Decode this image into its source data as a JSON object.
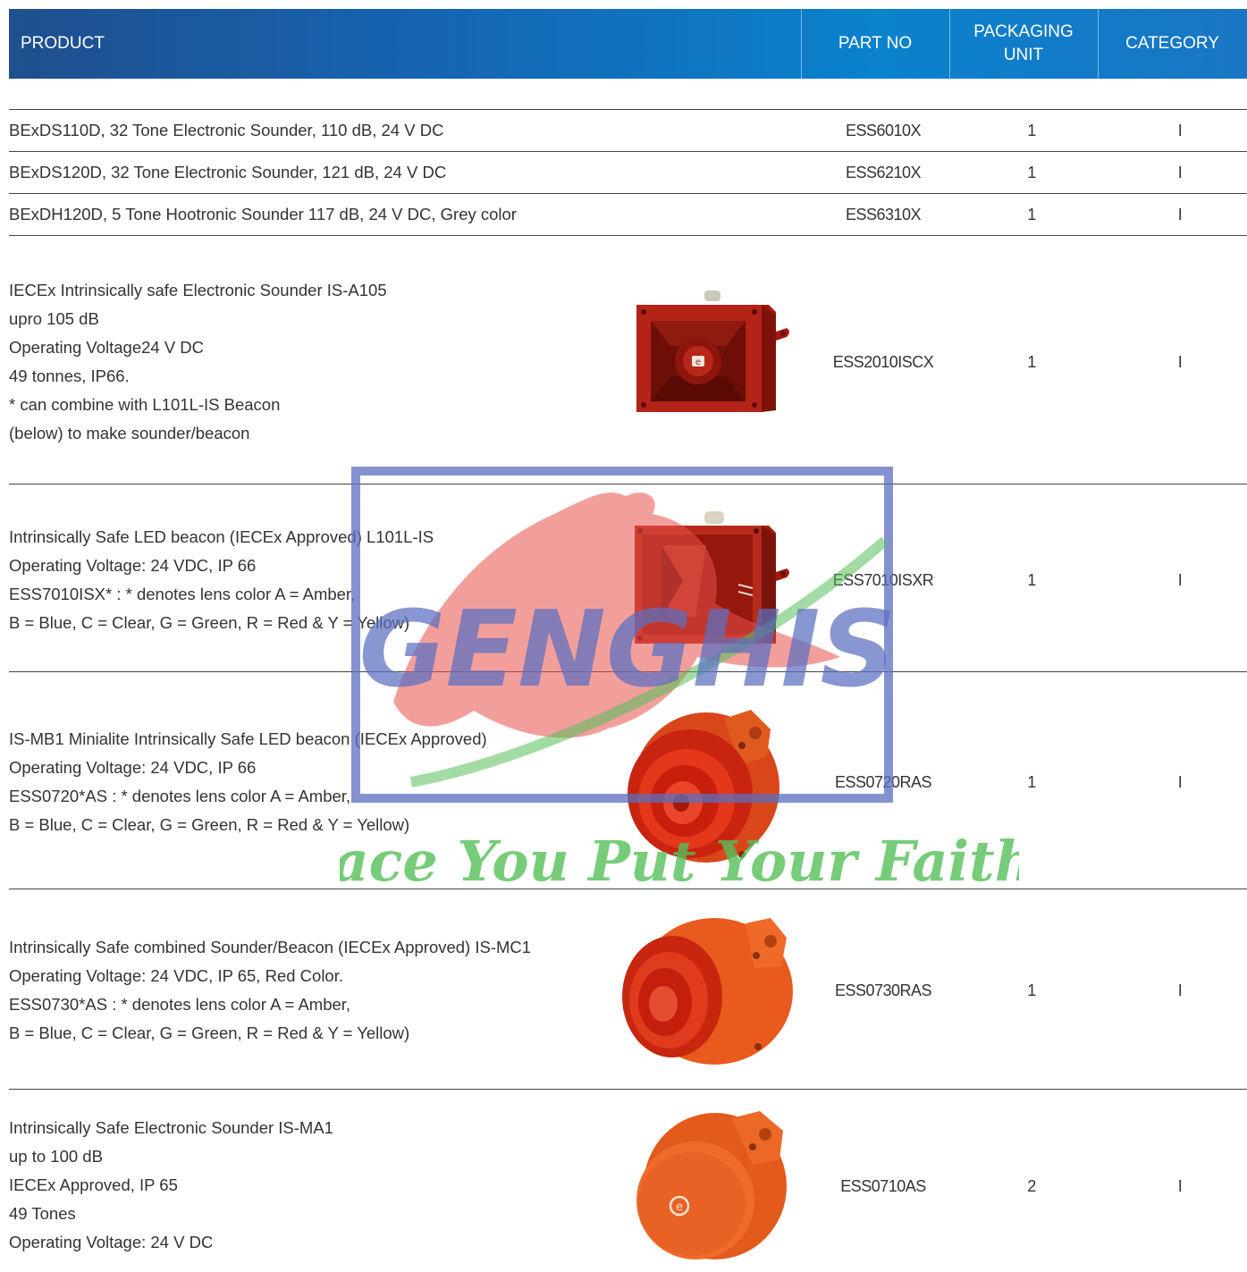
{
  "header": {
    "product": "PRODUCT",
    "part_no": "PART NO",
    "packaging_unit_line1": "PACKAGING",
    "packaging_unit_line2": "UNIT",
    "category": "CATEGORY",
    "gradient_colors": [
      "#1f4f8e",
      "#0a82cc"
    ]
  },
  "rows": [
    {
      "lines": [
        "BExDS110D, 32 Tone Electronic Sounder, 110 dB, 24 V DC"
      ],
      "part_no": "ESS6010X",
      "unit": "1",
      "category": "I"
    },
    {
      "lines": [
        "BExDS120D, 32 Tone Electronic Sounder, 121 dB, 24 V DC"
      ],
      "part_no": "ESS6210X",
      "unit": "1",
      "category": "I"
    },
    {
      "lines": [
        "BExDH120D, 5 Tone Hootronic Sounder 117 dB, 24 V DC, Grey color"
      ],
      "part_no": "ESS6310X",
      "unit": "1",
      "category": "I"
    },
    {
      "lines": [
        "IECEx Intrinsically safe Electronic Sounder IS-A105",
        "upro 105 dB",
        "Operating Voltage24 V DC",
        "49 tonnes, IP66.",
        "* can combine with L101L-IS Beacon",
        "(below) to make sounder/beacon"
      ],
      "part_no": "ESS2010ISCX",
      "unit": "1",
      "category": "I",
      "image": "sounder-box"
    },
    {
      "lines": [
        "Intrinsically Safe LED beacon (IECEx Approved) L101L-IS",
        "Operating Voltage: 24 VDC, IP 66",
        "ESS7010ISX* : * denotes lens color A = Amber,",
        "B = Blue, C = Clear, G = Green, R = Red & Y = Yellow)"
      ],
      "part_no": "ESS7010ISXR",
      "unit": "1",
      "category": "I",
      "image": "beacon-box"
    },
    {
      "lines": [
        "IS-MB1 Minialite Intrinsically Safe LED beacon (IECEx Approved)",
        "Operating Voltage: 24 VDC, IP 66",
        "ESS0720*AS : * denotes lens color A = Amber,",
        "B = Blue, C = Clear, G = Green, R = Red & Y = Yellow)"
      ],
      "part_no": "ESS0720RAS",
      "unit": "1",
      "category": "I",
      "image": "minialite-beacon"
    },
    {
      "lines": [
        "Intrinsically Safe combined Sounder/Beacon (IECEx Approved) IS-MC1",
        "Operating Voltage: 24 VDC, IP 65, Red Color.",
        "ESS0730*AS : * denotes lens color A = Amber,",
        "B = Blue, C = Clear, G = Green, R = Red & Y = Yellow)"
      ],
      "part_no": "ESS0730RAS",
      "unit": "1",
      "category": "I",
      "image": "sounder-beacon"
    },
    {
      "lines": [
        "Intrinsically Safe Electronic Sounder IS-MA1",
        "up to 100 dB",
        "IECEx Approved, IP 65",
        "49 Tones",
        "Operating Voltage: 24 V DC"
      ],
      "part_no": "ESS0710AS",
      "unit": "2",
      "category": "I",
      "image": "round-sounder"
    }
  ],
  "watermark": {
    "brand": "GENGHIS",
    "tagline": "Place You Put Your Faith",
    "brand_color": "#5b6fc0",
    "tagline_color": "#56c05a"
  }
}
